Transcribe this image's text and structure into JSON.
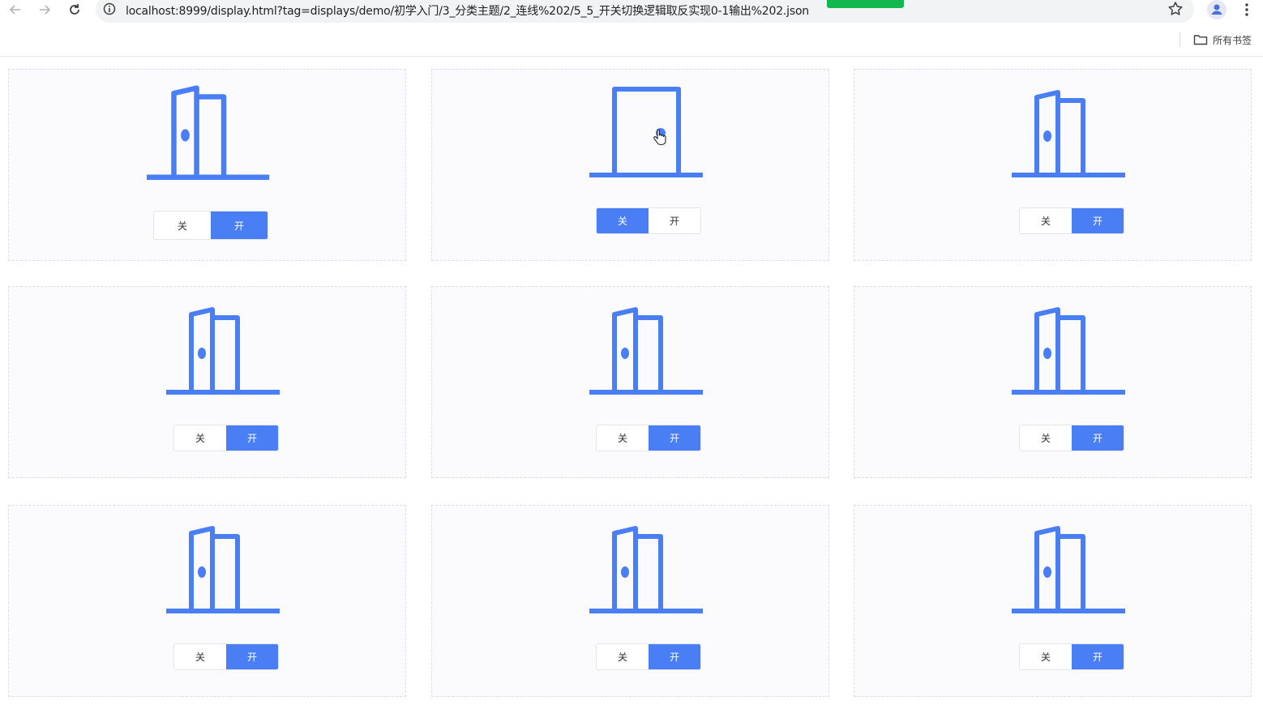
{
  "browser": {
    "url": "localhost:8999/display.html?tag=displays/demo/初学入门/3_分类主题/2_连线%202/5_5_开关切换逻辑取反实现0-1输出%202.json",
    "bookmarks_label": "所有书签"
  },
  "colors": {
    "accent": "#4a7ef5",
    "door_stroke": "#4a7ef5",
    "card_bg": "#fbfbfe"
  },
  "cards": [
    {
      "door": "open-door-icon",
      "off_label": "关",
      "on_label": "开",
      "selected": "on"
    },
    {
      "door": "closed-door-icon",
      "off_label": "关",
      "on_label": "开",
      "selected": "off"
    },
    {
      "door": "open-door-icon",
      "off_label": "关",
      "on_label": "开",
      "selected": "on"
    },
    {
      "door": "open-door-icon",
      "off_label": "关",
      "on_label": "开",
      "selected": "on"
    },
    {
      "door": "open-door-icon",
      "off_label": "关",
      "on_label": "开",
      "selected": "on"
    },
    {
      "door": "open-door-icon",
      "off_label": "关",
      "on_label": "开",
      "selected": "on"
    },
    {
      "door": "open-door-icon",
      "off_label": "关",
      "on_label": "开",
      "selected": "on"
    },
    {
      "door": "open-door-icon",
      "off_label": "关",
      "on_label": "开",
      "selected": "on"
    },
    {
      "door": "open-door-icon",
      "off_label": "关",
      "on_label": "开",
      "selected": "on"
    }
  ]
}
